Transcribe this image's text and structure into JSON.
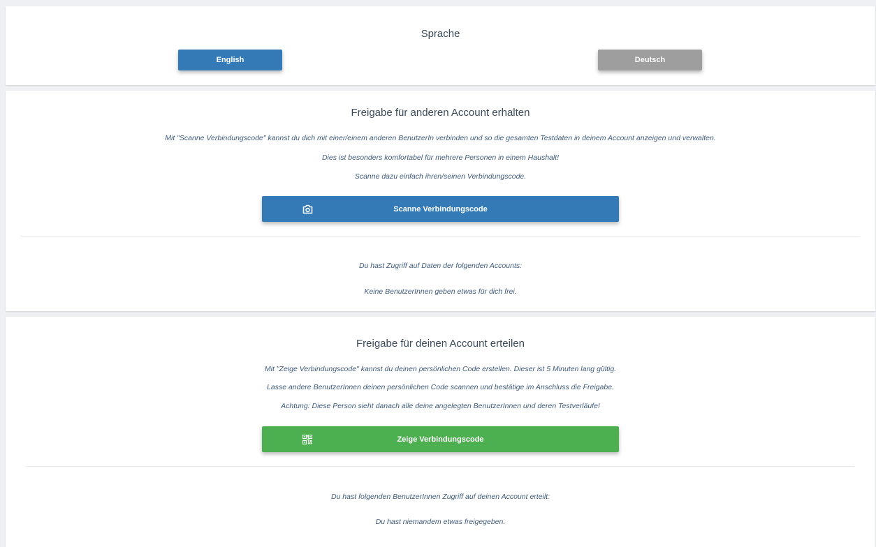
{
  "language": {
    "title": "Sprache",
    "english_label": "English",
    "deutsch_label": "Deutsch"
  },
  "receive": {
    "title": "Freigabe für anderen Account erhalten",
    "line1": "Mit \"Scanne Verbindungscode\" kannst du dich mit einer/einem anderen BenutzerIn verbinden und so die gesamten Testdaten in deinem Account anzeigen und verwalten.",
    "line2": "Dies ist besonders komfortabel für mehrere Personen in einem Haushalt!",
    "line3": "Scanne dazu einfach ihren/seinen Verbindungscode.",
    "button_label": "Scanne Verbindungscode",
    "access_heading": "Du hast Zugriff auf Daten der folgenden Accounts:",
    "access_empty": "Keine BenutzerInnen geben etwas für dich frei."
  },
  "grant": {
    "title": "Freigabe für deinen Account erteilen",
    "line1": "Mit \"Zeige Verbindungscode\" kannst du deinen persönlichen Code erstellen. Dieser ist 5 Minuten lang gültig.",
    "line2": "Lasse andere BenutzerInnen deinen persönlichen Code scannen und bestätige im Anschluss die Freigabe.",
    "line3": "Achtung: Diese Person sieht danach alle deine angelegten BenutzerInnen und deren Testverläufe!",
    "button_label": "Zeige Verbindungscode",
    "granted_heading": "Du hast folgenden BenutzerInnen Zugriff auf deinen Account erteilt:",
    "granted_empty": "Du hast niemandem etwas freigegeben."
  },
  "colors": {
    "primary_blue": "#337ab7",
    "inactive_grey": "#9e9e9e",
    "success_green": "#4caf50"
  },
  "icons": {
    "scan_button_icon": "camera-icon",
    "show_button_icon": "qr-code-icon"
  }
}
